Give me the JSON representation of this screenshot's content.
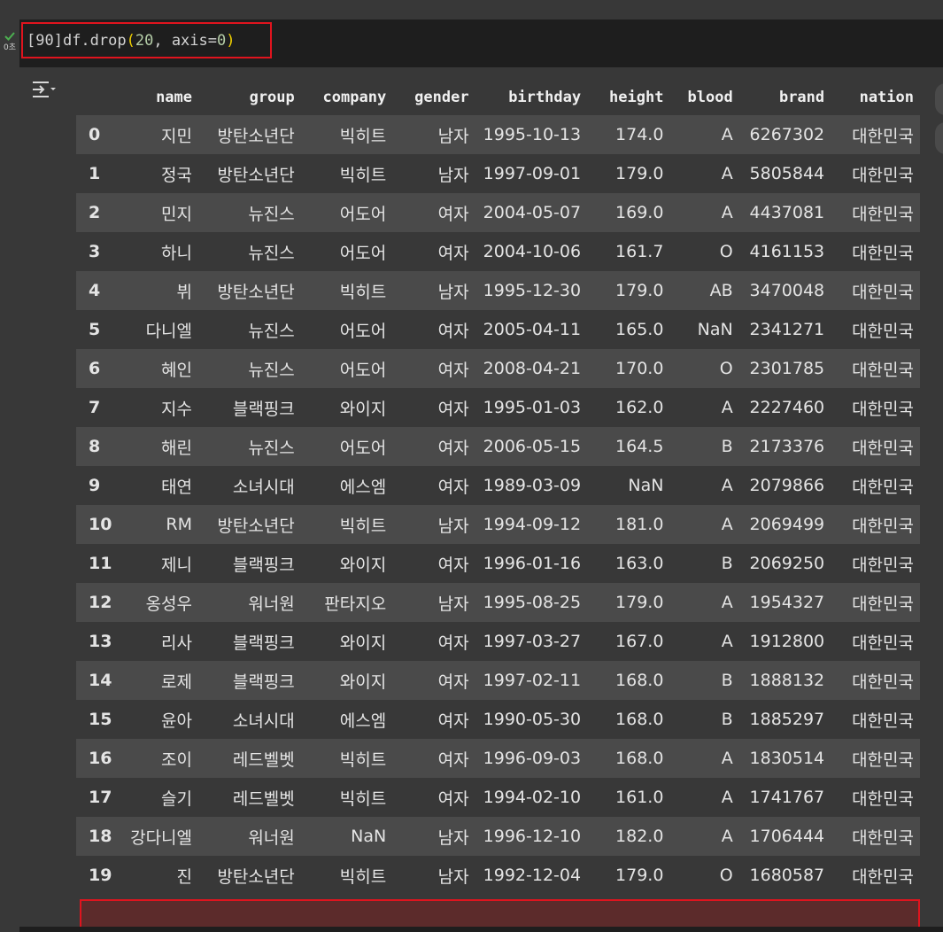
{
  "cell": {
    "exec_count": "[90]",
    "code_fn": "df.drop",
    "code_open": "(",
    "code_arg1": "20",
    "code_sep": ", axis=",
    "code_arg2": "0",
    "code_close": ")",
    "status_icon": "check-icon",
    "exec_time": "0초",
    "colors": {
      "status_ok": "#4caf50",
      "highlight_border": "#e0141e",
      "paren": "#f0d000"
    }
  },
  "output": {
    "toggle_icon": "output-toggle-icon",
    "table": {
      "columns": [
        "",
        "name",
        "group",
        "company",
        "gender",
        "birthday",
        "height",
        "blood",
        "brand",
        "nation"
      ],
      "rows": [
        [
          "0",
          "지민",
          "방탄소년단",
          "빅히트",
          "남자",
          "1995-10-13",
          "174.0",
          "A",
          "6267302",
          "대한민국"
        ],
        [
          "1",
          "정국",
          "방탄소년단",
          "빅히트",
          "남자",
          "1997-09-01",
          "179.0",
          "A",
          "5805844",
          "대한민국"
        ],
        [
          "2",
          "민지",
          "뉴진스",
          "어도어",
          "여자",
          "2004-05-07",
          "169.0",
          "A",
          "4437081",
          "대한민국"
        ],
        [
          "3",
          "하니",
          "뉴진스",
          "어도어",
          "여자",
          "2004-10-06",
          "161.7",
          "O",
          "4161153",
          "대한민국"
        ],
        [
          "4",
          "뷔",
          "방탄소년단",
          "빅히트",
          "남자",
          "1995-12-30",
          "179.0",
          "AB",
          "3470048",
          "대한민국"
        ],
        [
          "5",
          "다니엘",
          "뉴진스",
          "어도어",
          "여자",
          "2005-04-11",
          "165.0",
          "NaN",
          "2341271",
          "대한민국"
        ],
        [
          "6",
          "혜인",
          "뉴진스",
          "어도어",
          "여자",
          "2008-04-21",
          "170.0",
          "O",
          "2301785",
          "대한민국"
        ],
        [
          "7",
          "지수",
          "블랙핑크",
          "와이지",
          "여자",
          "1995-01-03",
          "162.0",
          "A",
          "2227460",
          "대한민국"
        ],
        [
          "8",
          "해린",
          "뉴진스",
          "어도어",
          "여자",
          "2006-05-15",
          "164.5",
          "B",
          "2173376",
          "대한민국"
        ],
        [
          "9",
          "태연",
          "소녀시대",
          "에스엠",
          "여자",
          "1989-03-09",
          "NaN",
          "A",
          "2079866",
          "대한민국"
        ],
        [
          "10",
          "RM",
          "방탄소년단",
          "빅히트",
          "남자",
          "1994-09-12",
          "181.0",
          "A",
          "2069499",
          "대한민국"
        ],
        [
          "11",
          "제니",
          "블랙핑크",
          "와이지",
          "여자",
          "1996-01-16",
          "163.0",
          "B",
          "2069250",
          "대한민국"
        ],
        [
          "12",
          "옹성우",
          "워너원",
          "판타지오",
          "남자",
          "1995-08-25",
          "179.0",
          "A",
          "1954327",
          "대한민국"
        ],
        [
          "13",
          "리사",
          "블랙핑크",
          "와이지",
          "여자",
          "1997-03-27",
          "167.0",
          "A",
          "1912800",
          "대한민국"
        ],
        [
          "14",
          "로제",
          "블랙핑크",
          "와이지",
          "여자",
          "1997-02-11",
          "168.0",
          "B",
          "1888132",
          "대한민국"
        ],
        [
          "15",
          "윤아",
          "소녀시대",
          "에스엠",
          "여자",
          "1990-05-30",
          "168.0",
          "B",
          "1885297",
          "대한민국"
        ],
        [
          "16",
          "조이",
          "레드벨벳",
          "빅히트",
          "여자",
          "1996-09-03",
          "168.0",
          "A",
          "1830514",
          "대한민국"
        ],
        [
          "17",
          "슬기",
          "레드벨벳",
          "빅히트",
          "여자",
          "1994-02-10",
          "161.0",
          "A",
          "1741767",
          "대한민국"
        ],
        [
          "18",
          "강다니엘",
          "워너원",
          "NaN",
          "남자",
          "1996-12-10",
          "182.0",
          "A",
          "1706444",
          "대한민국"
        ],
        [
          "19",
          "진",
          "방탄소년단",
          "빅히트",
          "남자",
          "1992-12-04",
          "179.0",
          "O",
          "1680587",
          "대한민국"
        ]
      ]
    }
  }
}
